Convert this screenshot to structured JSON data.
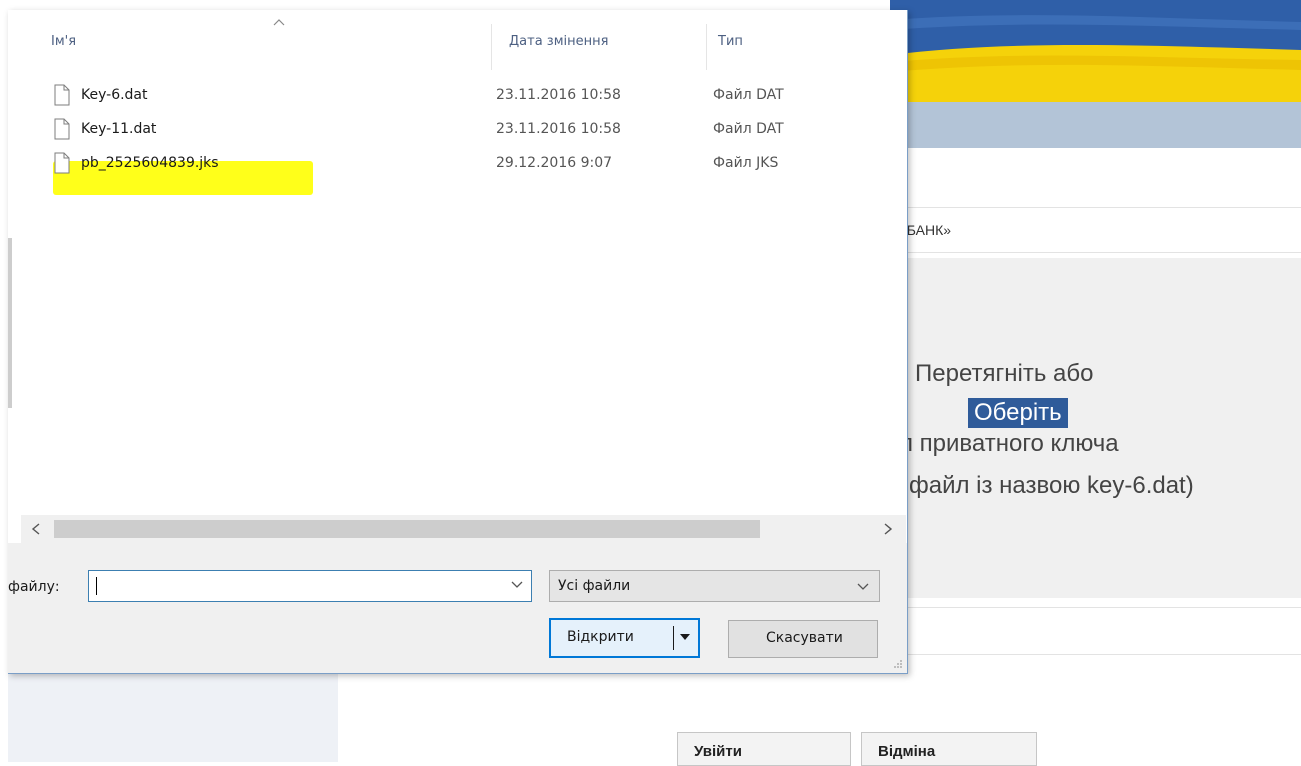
{
  "background_page": {
    "bank_label_fragment": "АТБАНК»",
    "dropzone": {
      "line1": "Перетягніть або",
      "choose_button": "Оберіть",
      "line3": "л приватного ключа",
      "line4": "файл із назвою key-6.dat)"
    },
    "login_button": "Увійти",
    "cancel_button": "Відміна",
    "colors": {
      "flag_blue": "#2f5fa8",
      "flag_yellow": "#f5d20a",
      "nav": "#b3c4d7",
      "choose_bg": "#2f5b9a"
    }
  },
  "dialog": {
    "columns": {
      "name": "Ім'я",
      "modified": "Дата змінення",
      "type": "Тип"
    },
    "files": [
      {
        "name": "Key-6.dat",
        "modified": "23.11.2016 10:58",
        "type": "Файл DAT",
        "highlighted": false
      },
      {
        "name": "Key-11.dat",
        "modified": "23.11.2016 10:58",
        "type": "Файл DAT",
        "highlighted": false
      },
      {
        "name": "pb_2525604839.jks",
        "modified": "29.12.2016 9:07",
        "type": "Файл JKS",
        "highlighted": true
      }
    ],
    "filename_label": "файлу:",
    "filename_value": "",
    "file_type_selected": "Усі файли",
    "open_button": "Відкрити",
    "cancel_button": "Скасувати",
    "icons": {
      "sort": "sort-up-icon",
      "file": "file-icon",
      "dropdown": "chevron-down-icon",
      "scroll_left": "chevron-left-icon",
      "scroll_right": "chevron-right-icon",
      "resize": "resize-grip-icon"
    },
    "colors": {
      "highlight": "#ffff1a",
      "focus_border": "#0078d7",
      "header_text": "#4d6082"
    }
  }
}
